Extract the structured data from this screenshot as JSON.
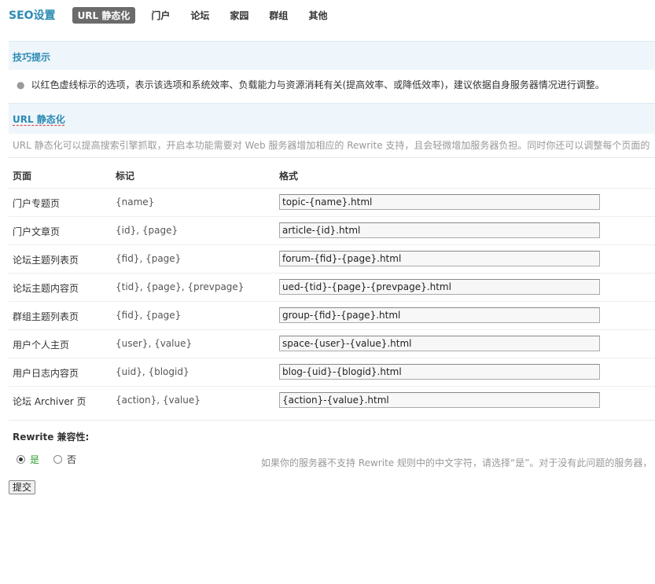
{
  "header": {
    "title": "SEO设置",
    "tabs": [
      {
        "label": "URL 静态化",
        "active": true
      },
      {
        "label": "门户"
      },
      {
        "label": "论坛"
      },
      {
        "label": "家园"
      },
      {
        "label": "群组"
      },
      {
        "label": "其他"
      }
    ]
  },
  "tips": {
    "title": "技巧提示",
    "items": [
      "以红色虚线标示的选项，表示该选项和系统效率、负载能力与资源消耗有关(提高效率、或降低效率)，建议依据自身服务器情况进行调整。"
    ]
  },
  "url_static": {
    "title": "URL 静态化",
    "description": "URL 静态化可以提高搜索引擎抓取，开启本功能需要对 Web 服务器增加相应的 Rewrite 支持，且会轻微增加服务器负担。同时你还可以调整每个页面的",
    "columns": [
      "页面",
      "标记",
      "格式"
    ],
    "rows": [
      {
        "page": "门户专题页",
        "marker": "{name}",
        "format": "topic-{name}.html"
      },
      {
        "page": "门户文章页",
        "marker": "{id}, {page}",
        "format": "article-{id}.html"
      },
      {
        "page": "论坛主题列表页",
        "marker": "{fid}, {page}",
        "format": "forum-{fid}-{page}.html"
      },
      {
        "page": "论坛主题内容页",
        "marker": "{tid}, {page}, {prevpage}",
        "format": "ued-{tid}-{page}-{prevpage}.html"
      },
      {
        "page": "群组主题列表页",
        "marker": "{fid}, {page}",
        "format": "group-{fid}-{page}.html"
      },
      {
        "page": "用户个人主页",
        "marker": "{user}, {value}",
        "format": "space-{user}-{value}.html"
      },
      {
        "page": "用户日志内容页",
        "marker": "{uid}, {blogid}",
        "format": "blog-{uid}-{blogid}.html"
      },
      {
        "page": "论坛 Archiver 页",
        "marker": "{action}, {value}",
        "format": "{action}-{value}.html"
      }
    ]
  },
  "rewrite": {
    "label": "Rewrite 兼容性:",
    "options": [
      {
        "label": "是",
        "checked": true
      },
      {
        "label": "否",
        "checked": false
      }
    ],
    "comment": "如果你的服务器不支持 Rewrite 规则中的中文字符，请选择“是”。对于没有此问题的服务器，"
  },
  "submit_label": "提交"
}
